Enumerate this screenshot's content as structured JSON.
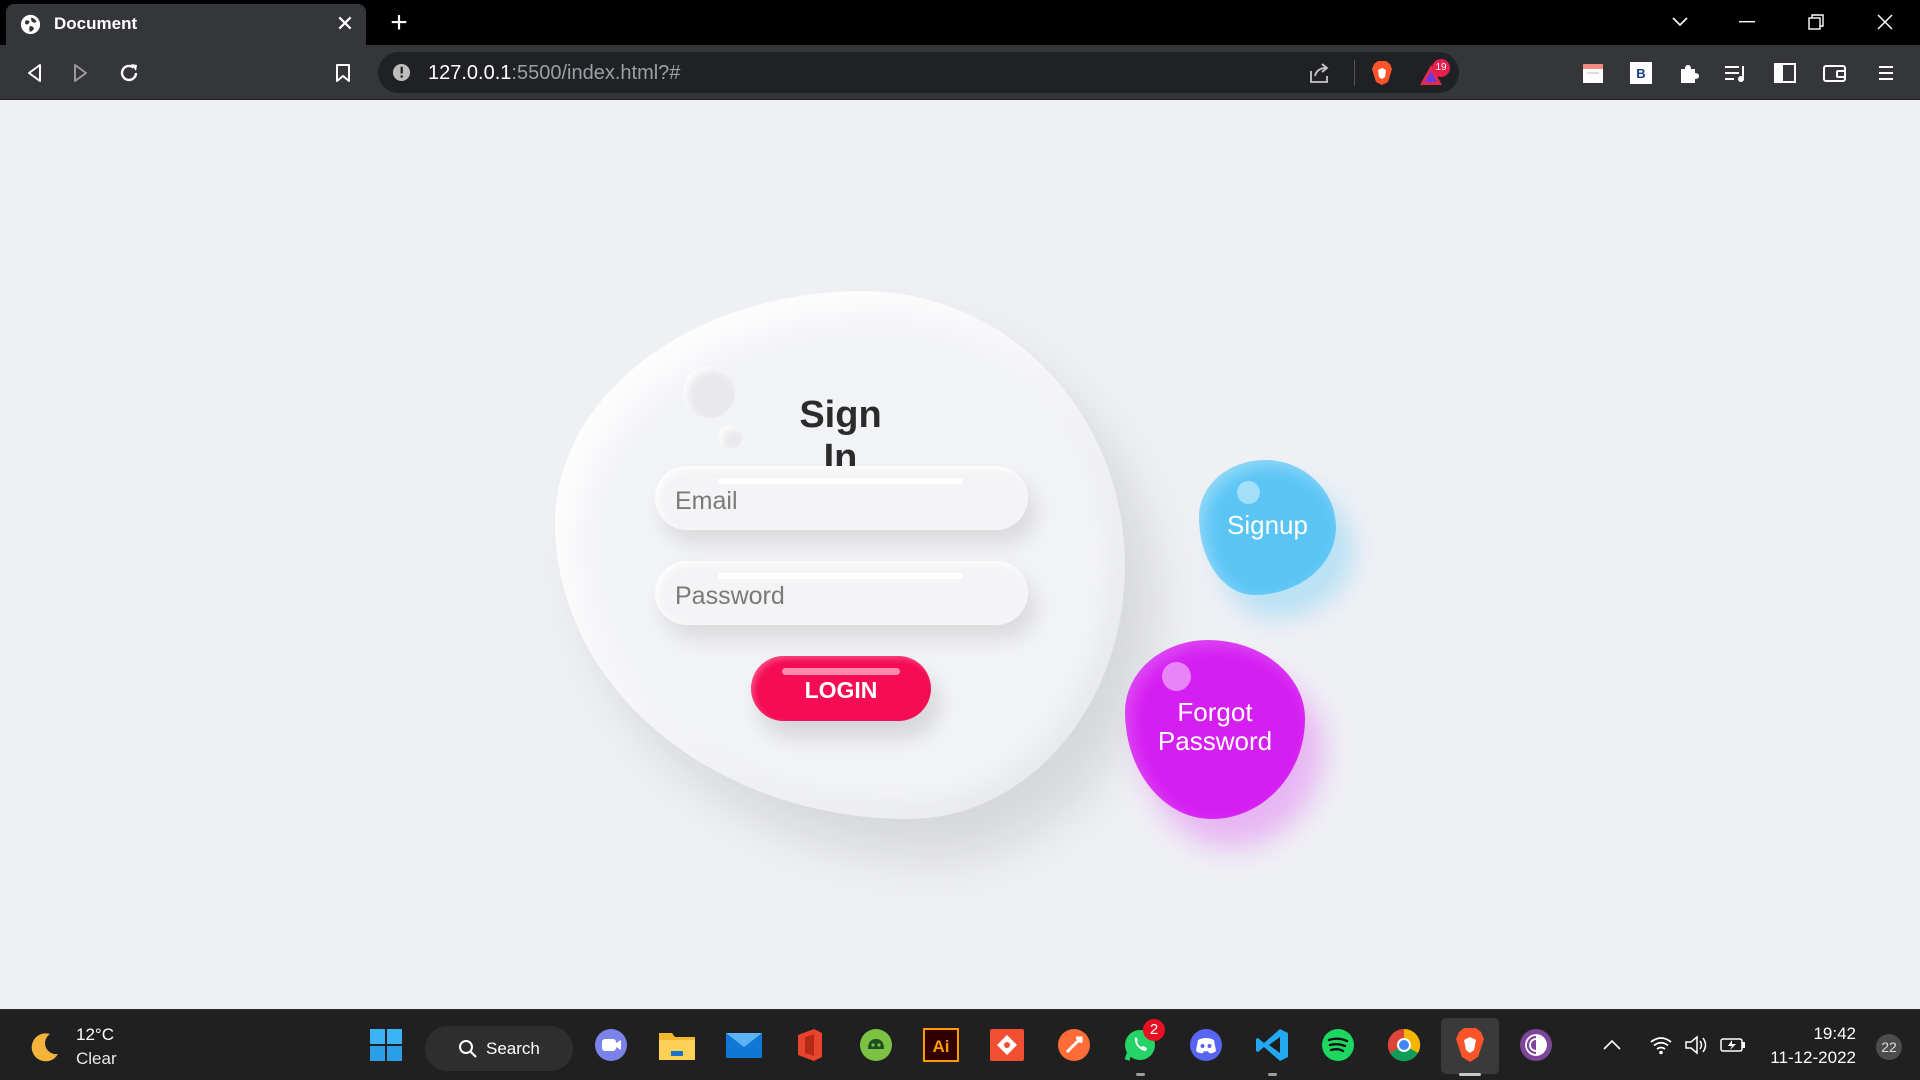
{
  "browser": {
    "tab_title": "Document",
    "url_host": "127.0.0.1",
    "url_path": ":5500/index.html?#",
    "brave_rewards_count": "19"
  },
  "signin": {
    "title": "Sign In",
    "email_placeholder": "Email",
    "password_placeholder": "Password",
    "login_label": "LOGIN",
    "signup_label": "Signup",
    "forgot_label_line1": "Forgot",
    "forgot_label_line2": "Password"
  },
  "taskbar": {
    "weather_temp": "12°C",
    "weather_desc": "Clear",
    "search_label": "Search",
    "whatsapp_badge": "2",
    "time": "19:42",
    "date": "11-12-2022",
    "notification_count": "22"
  },
  "colors": {
    "login_button": "#f50c55",
    "signup_blob": "#5ac5f5",
    "forgot_blob": "#d51ef2",
    "page_background": "#eff0f4"
  }
}
